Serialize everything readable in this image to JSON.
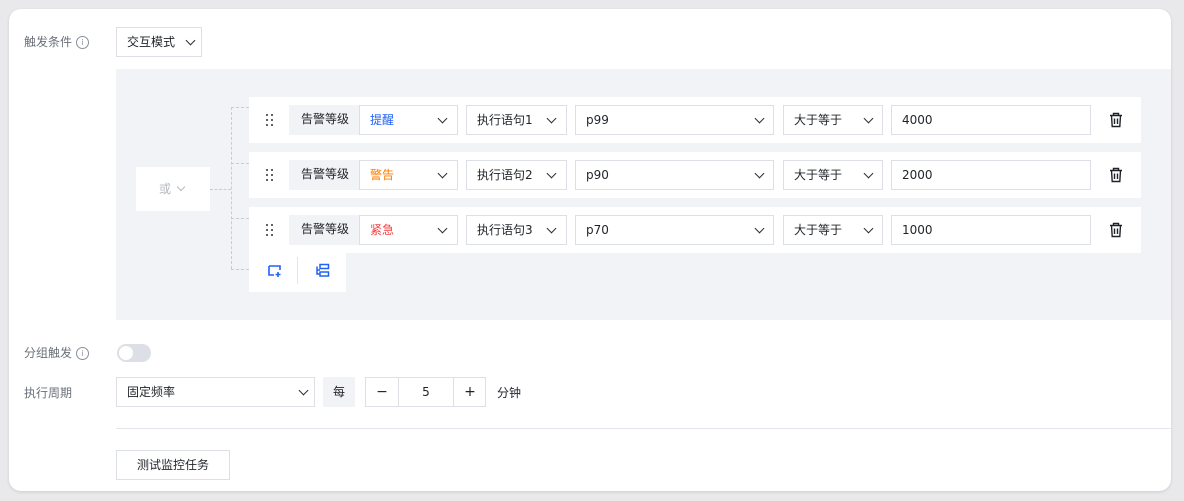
{
  "trigger": {
    "label": "触发条件",
    "info_glyph": "i",
    "mode_value": "交互模式",
    "logic_op": "或",
    "rules": [
      {
        "tag": "告警等级",
        "level": "提醒",
        "level_color": "#2162f5",
        "stmt": "执行语句1",
        "metric": "p99",
        "op": "大于等于",
        "value": "4000"
      },
      {
        "tag": "告警等级",
        "level": "警告",
        "level_color": "#ff7d00",
        "stmt": "执行语句2",
        "metric": "p90",
        "op": "大于等于",
        "value": "2000"
      },
      {
        "tag": "告警等级",
        "level": "紧急",
        "level_color": "#f53f3f",
        "stmt": "执行语句3",
        "metric": "p70",
        "op": "大于等于",
        "value": "1000"
      }
    ],
    "add_icons": [
      "add-condition-icon",
      "add-group-icon"
    ],
    "accent_color": "#2162f5"
  },
  "group_trigger": {
    "label": "分组触发",
    "info_glyph": "i",
    "enabled": false
  },
  "period": {
    "label": "执行周期",
    "type_value": "固定频率",
    "every_label": "每",
    "minus": "−",
    "count": "5",
    "plus": "+",
    "unit": "分钟"
  },
  "test_button": "测试监控任务"
}
